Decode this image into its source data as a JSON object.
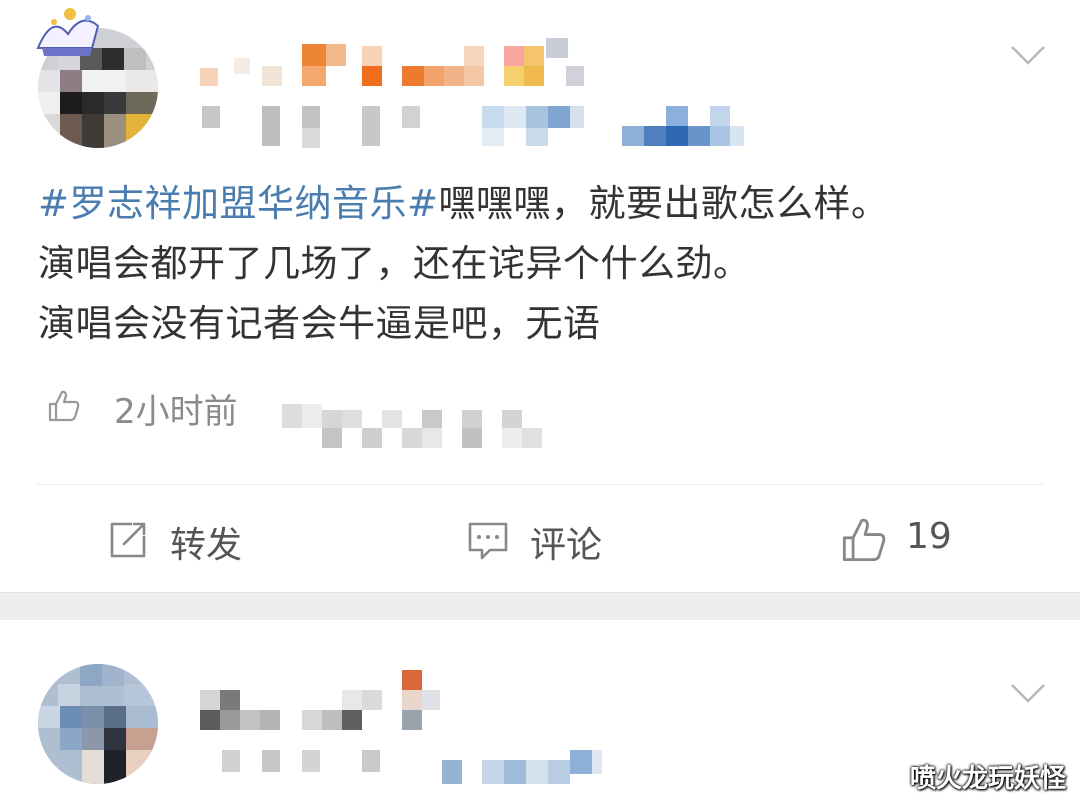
{
  "post1": {
    "text": {
      "hashtag": "#罗志祥加盟华纳音乐#",
      "line1_rest": "嘿嘿嘿，就要出歌怎么样。",
      "line2": "演唱会都开了几场了，还在诧异个什么劲。",
      "line3": "演唱会没有记者会牛逼是吧，无语"
    },
    "meta": {
      "time": "2小时前"
    },
    "actions": {
      "repost_label": "转发",
      "comment_label": "评论",
      "like_count": "19"
    }
  },
  "watermark": "喷火龙玩妖怪",
  "icons": {
    "repost": "repost-icon",
    "comment": "comment-icon",
    "like": "thumbs-up-icon",
    "more": "chevron-down-icon",
    "crown": "crown-icon"
  },
  "colors": {
    "hashtag": "#4a7cb0",
    "text": "#333333",
    "meta": "#8b8b8b",
    "separator": "#eeeeee"
  }
}
